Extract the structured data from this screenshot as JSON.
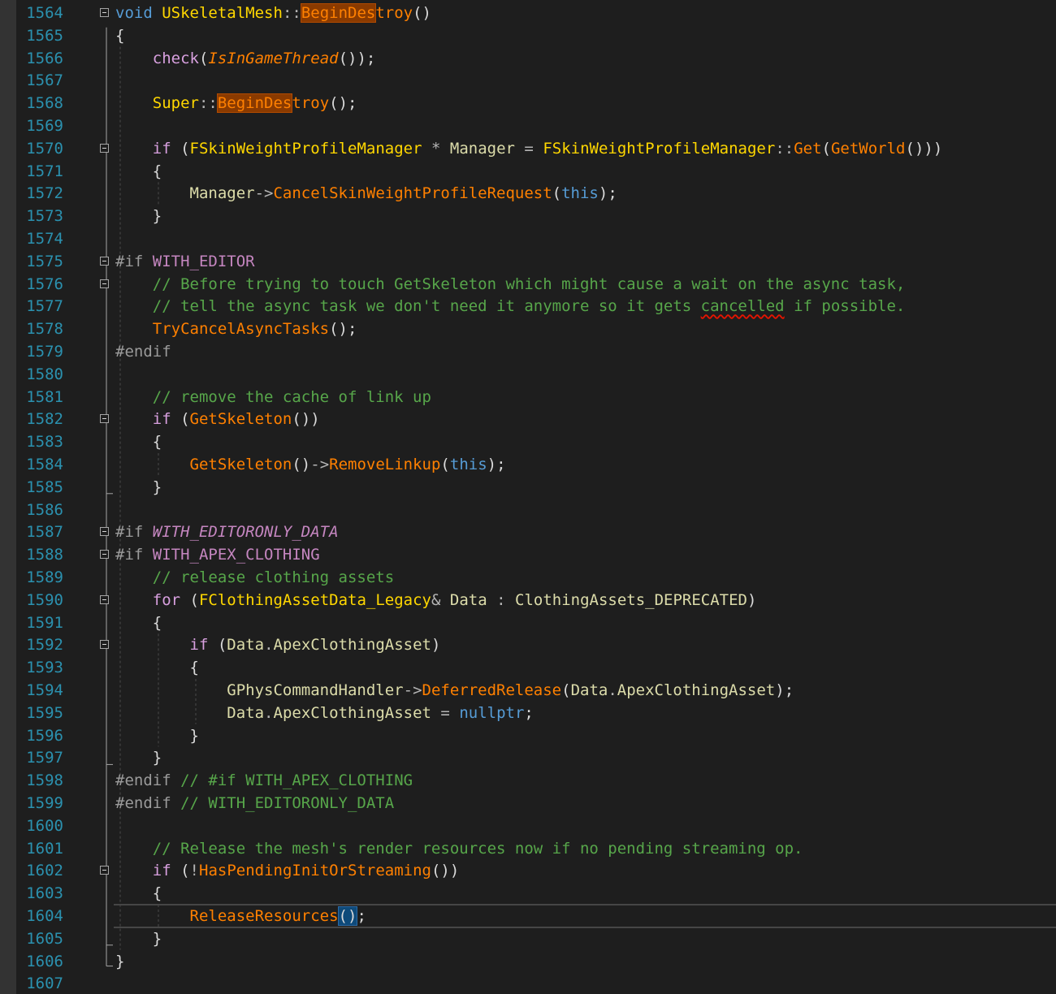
{
  "editor": {
    "language": "cpp",
    "current_line": "1604",
    "lines": [
      {
        "n": "1564",
        "fold": true,
        "tokens": [
          [
            "kw",
            "void"
          ],
          [
            "id",
            " "
          ],
          [
            "ty",
            "USkeletalMesh"
          ],
          [
            "op",
            "::"
          ],
          [
            "fn hl",
            "BeginDes"
          ],
          [
            "fn",
            "troy"
          ],
          [
            "id",
            "()"
          ]
        ]
      },
      {
        "n": "1565",
        "tokens": [
          [
            "id",
            "{"
          ]
        ]
      },
      {
        "n": "1566",
        "tokens": [
          [
            "id",
            "    "
          ],
          [
            "kw2",
            "check"
          ],
          [
            "id",
            "("
          ],
          [
            "fni",
            "IsInGameThread"
          ],
          [
            "id",
            "());"
          ]
        ]
      },
      {
        "n": "1567",
        "tokens": []
      },
      {
        "n": "1568",
        "tokens": [
          [
            "id",
            "    "
          ],
          [
            "ty",
            "Super"
          ],
          [
            "op",
            "::"
          ],
          [
            "fn hl",
            "BeginDes"
          ],
          [
            "fn",
            "troy"
          ],
          [
            "id",
            "();"
          ]
        ]
      },
      {
        "n": "1569",
        "tokens": []
      },
      {
        "n": "1570",
        "fold": true,
        "tokens": [
          [
            "id",
            "    "
          ],
          [
            "kw2",
            "if"
          ],
          [
            "id",
            " ("
          ],
          [
            "ty",
            "FSkinWeightProfileManager"
          ],
          [
            "id",
            " "
          ],
          [
            "op",
            "*"
          ],
          [
            "id",
            " "
          ],
          [
            "var",
            "Manager"
          ],
          [
            "id",
            " "
          ],
          [
            "op",
            "="
          ],
          [
            "id",
            " "
          ],
          [
            "ty",
            "FSkinWeightProfileManager"
          ],
          [
            "op",
            "::"
          ],
          [
            "fn",
            "Get"
          ],
          [
            "id",
            "("
          ],
          [
            "fn",
            "GetWorld"
          ],
          [
            "id",
            "()))"
          ]
        ]
      },
      {
        "n": "1571",
        "tokens": [
          [
            "id",
            "    {"
          ]
        ]
      },
      {
        "n": "1572",
        "tokens": [
          [
            "id",
            "        "
          ],
          [
            "var",
            "Manager"
          ],
          [
            "op",
            "->"
          ],
          [
            "fn",
            "CancelSkinWeightProfileRequest"
          ],
          [
            "id",
            "("
          ],
          [
            "kw",
            "this"
          ],
          [
            "id",
            ");"
          ]
        ]
      },
      {
        "n": "1573",
        "tokens": [
          [
            "id",
            "    }"
          ]
        ]
      },
      {
        "n": "1574",
        "tokens": []
      },
      {
        "n": "1575",
        "fold": true,
        "tokens": [
          [
            "pp",
            "#if"
          ],
          [
            "id",
            " "
          ],
          [
            "mac",
            "WITH_EDITOR"
          ]
        ]
      },
      {
        "n": "1576",
        "fold": true,
        "tokens": [
          [
            "id",
            "    "
          ],
          [
            "cm",
            "// Before trying to touch GetSkeleton which might cause a wait on the async task,"
          ]
        ]
      },
      {
        "n": "1577",
        "tokens": [
          [
            "id",
            "    "
          ],
          [
            "cm",
            "// tell the async task we don't need it anymore so it gets "
          ],
          [
            "cm sq",
            "cancelled"
          ],
          [
            "cm",
            " if possible."
          ]
        ]
      },
      {
        "n": "1578",
        "tokens": [
          [
            "id",
            "    "
          ],
          [
            "fn",
            "TryCancelAsyncTasks"
          ],
          [
            "id",
            "();"
          ]
        ]
      },
      {
        "n": "1579",
        "tokens": [
          [
            "pp",
            "#endif"
          ]
        ]
      },
      {
        "n": "1580",
        "tokens": []
      },
      {
        "n": "1581",
        "tokens": [
          [
            "id",
            "    "
          ],
          [
            "cm",
            "// remove the cache of link up"
          ]
        ]
      },
      {
        "n": "1582",
        "fold": true,
        "tokens": [
          [
            "id",
            "    "
          ],
          [
            "kw2",
            "if"
          ],
          [
            "id",
            " ("
          ],
          [
            "fn",
            "GetSkeleton"
          ],
          [
            "id",
            "())"
          ]
        ]
      },
      {
        "n": "1583",
        "tokens": [
          [
            "id",
            "    {"
          ]
        ]
      },
      {
        "n": "1584",
        "tokens": [
          [
            "id",
            "        "
          ],
          [
            "fn",
            "GetSkeleton"
          ],
          [
            "id",
            "()"
          ],
          [
            "op",
            "->"
          ],
          [
            "fn",
            "RemoveLinkup"
          ],
          [
            "id",
            "("
          ],
          [
            "kw",
            "this"
          ],
          [
            "id",
            ");"
          ]
        ]
      },
      {
        "n": "1585",
        "tokens": [
          [
            "id",
            "    }"
          ]
        ]
      },
      {
        "n": "1586",
        "tokens": []
      },
      {
        "n": "1587",
        "fold": true,
        "tokens": [
          [
            "pp",
            "#if"
          ],
          [
            "id",
            " "
          ],
          [
            "maci",
            "WITH_EDITORONLY_DATA"
          ]
        ]
      },
      {
        "n": "1588",
        "fold": true,
        "tokens": [
          [
            "pp",
            "#if"
          ],
          [
            "id",
            " "
          ],
          [
            "mac",
            "WITH_APEX_CLOTHING"
          ]
        ]
      },
      {
        "n": "1589",
        "tokens": [
          [
            "id",
            "    "
          ],
          [
            "cm",
            "// release clothing assets"
          ]
        ]
      },
      {
        "n": "1590",
        "fold": true,
        "tokens": [
          [
            "id",
            "    "
          ],
          [
            "kw2",
            "for"
          ],
          [
            "id",
            " ("
          ],
          [
            "ty",
            "FClothingAssetData_Legacy"
          ],
          [
            "op",
            "&"
          ],
          [
            "id",
            " "
          ],
          [
            "var",
            "Data"
          ],
          [
            "id",
            " "
          ],
          [
            "op",
            ":"
          ],
          [
            "id",
            " "
          ],
          [
            "var",
            "ClothingAssets_DEPRECATED"
          ],
          [
            "id",
            ")"
          ]
        ]
      },
      {
        "n": "1591",
        "tokens": [
          [
            "id",
            "    {"
          ]
        ]
      },
      {
        "n": "1592",
        "fold": true,
        "tokens": [
          [
            "id",
            "        "
          ],
          [
            "kw2",
            "if"
          ],
          [
            "id",
            " ("
          ],
          [
            "var",
            "Data"
          ],
          [
            "op",
            "."
          ],
          [
            "var",
            "ApexClothingAsset"
          ],
          [
            "id",
            ")"
          ]
        ]
      },
      {
        "n": "1593",
        "tokens": [
          [
            "id",
            "        {"
          ]
        ]
      },
      {
        "n": "1594",
        "tokens": [
          [
            "id",
            "            "
          ],
          [
            "var",
            "GPhysCommandHandler"
          ],
          [
            "op",
            "->"
          ],
          [
            "fn",
            "DeferredRelease"
          ],
          [
            "id",
            "("
          ],
          [
            "var",
            "Data"
          ],
          [
            "op",
            "."
          ],
          [
            "var",
            "ApexClothingAsset"
          ],
          [
            "id",
            ");"
          ]
        ]
      },
      {
        "n": "1595",
        "tokens": [
          [
            "id",
            "            "
          ],
          [
            "var",
            "Data"
          ],
          [
            "op",
            "."
          ],
          [
            "var",
            "ApexClothingAsset"
          ],
          [
            "id",
            " "
          ],
          [
            "op",
            "="
          ],
          [
            "id",
            " "
          ],
          [
            "kw",
            "nullptr"
          ],
          [
            "id",
            ";"
          ]
        ]
      },
      {
        "n": "1596",
        "tokens": [
          [
            "id",
            "        }"
          ]
        ]
      },
      {
        "n": "1597",
        "tokens": [
          [
            "id",
            "    }"
          ]
        ]
      },
      {
        "n": "1598",
        "tokens": [
          [
            "pp",
            "#endif"
          ],
          [
            "id",
            " "
          ],
          [
            "cm",
            "// #if WITH_APEX_CLOTHING"
          ]
        ]
      },
      {
        "n": "1599",
        "tokens": [
          [
            "pp",
            "#endif"
          ],
          [
            "id",
            " "
          ],
          [
            "cm",
            "// WITH_EDITORONLY_DATA"
          ]
        ]
      },
      {
        "n": "1600",
        "tokens": []
      },
      {
        "n": "1601",
        "tokens": [
          [
            "id",
            "    "
          ],
          [
            "cm",
            "// Release the mesh's render resources now if no pending streaming op."
          ]
        ]
      },
      {
        "n": "1602",
        "fold": true,
        "tokens": [
          [
            "id",
            "    "
          ],
          [
            "kw2",
            "if"
          ],
          [
            "id",
            " ("
          ],
          [
            "op",
            "!"
          ],
          [
            "fn",
            "HasPendingInitOrStreaming"
          ],
          [
            "id",
            "())"
          ]
        ]
      },
      {
        "n": "1603",
        "tokens": [
          [
            "id",
            "    {"
          ]
        ]
      },
      {
        "n": "1604",
        "tokens": [
          [
            "id",
            "        "
          ],
          [
            "fn",
            "ReleaseResources"
          ],
          [
            "caret",
            ""
          ],
          [
            "id brk",
            "()"
          ],
          [
            "id",
            ";"
          ]
        ]
      },
      {
        "n": "1605",
        "tokens": [
          [
            "id",
            "    }"
          ]
        ]
      },
      {
        "n": "1606",
        "tokens": [
          [
            "id",
            "}"
          ]
        ]
      },
      {
        "n": "1607",
        "tokens": []
      }
    ]
  },
  "colors": {
    "background": "#1e1e1e",
    "line_number": "#2b91af",
    "keyword": "#569cd6",
    "control_keyword": "#d8a0df",
    "function": "#ff8000",
    "type": "#ffd700",
    "macro": "#c586c0",
    "comment": "#57a64a",
    "preprocessor": "#9b9b9b",
    "variable": "#dcdcaa",
    "highlight": "#8a3a00"
  }
}
